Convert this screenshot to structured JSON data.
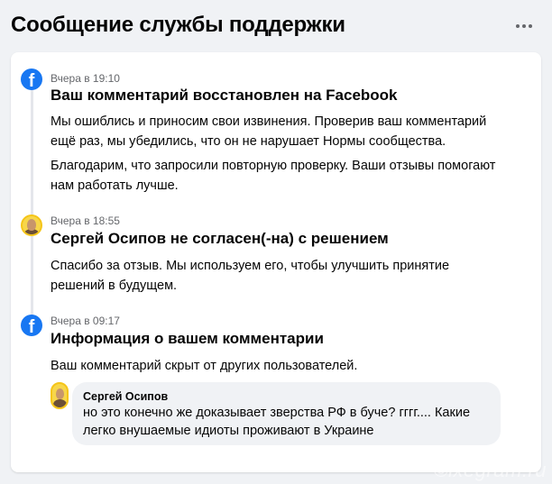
{
  "header": {
    "title": "Сообщение службы поддержки",
    "more_icon": "more-horizontal-icon"
  },
  "entries": [
    {
      "icon": "facebook-icon",
      "icon_glyph": "f",
      "time": "Вчера в 19:10",
      "title": "Ваш комментарий восстановлен на Facebook",
      "paragraphs": [
        "Мы ошиблись и приносим свои извинения. Проверив ваш комментарий ещё раз, мы убедились, что он не нарушает Нормы сообщества.",
        "Благодарим, что запросили повторную проверку. Ваши отзывы помогают нам работать лучше."
      ]
    },
    {
      "icon": "user-avatar",
      "time": "Вчера в 18:55",
      "title": "Сергей Осипов не согласен(-на) с решением",
      "paragraphs": [
        "Спасибо за отзыв. Мы используем его, чтобы улучшить принятие решений в будущем."
      ]
    },
    {
      "icon": "facebook-icon",
      "icon_glyph": "f",
      "time": "Вчера в 09:17",
      "title": "Информация о вашем комментарии",
      "paragraphs": [
        "Ваш комментарий скрыт от других пользователей."
      ],
      "comment": {
        "author": "Сергей Осипов",
        "text": "но это конечно же доказывает зверства РФ в буче? гггг.... Какие легко внушаемые идиоты проживают в Украине"
      }
    }
  ],
  "watermark": "©ixegram.ru",
  "colors": {
    "background": "#f0f2f5",
    "card": "#ffffff",
    "facebook_blue": "#1877f2",
    "secondary_text": "#65676b",
    "bubble": "#f0f2f5"
  }
}
